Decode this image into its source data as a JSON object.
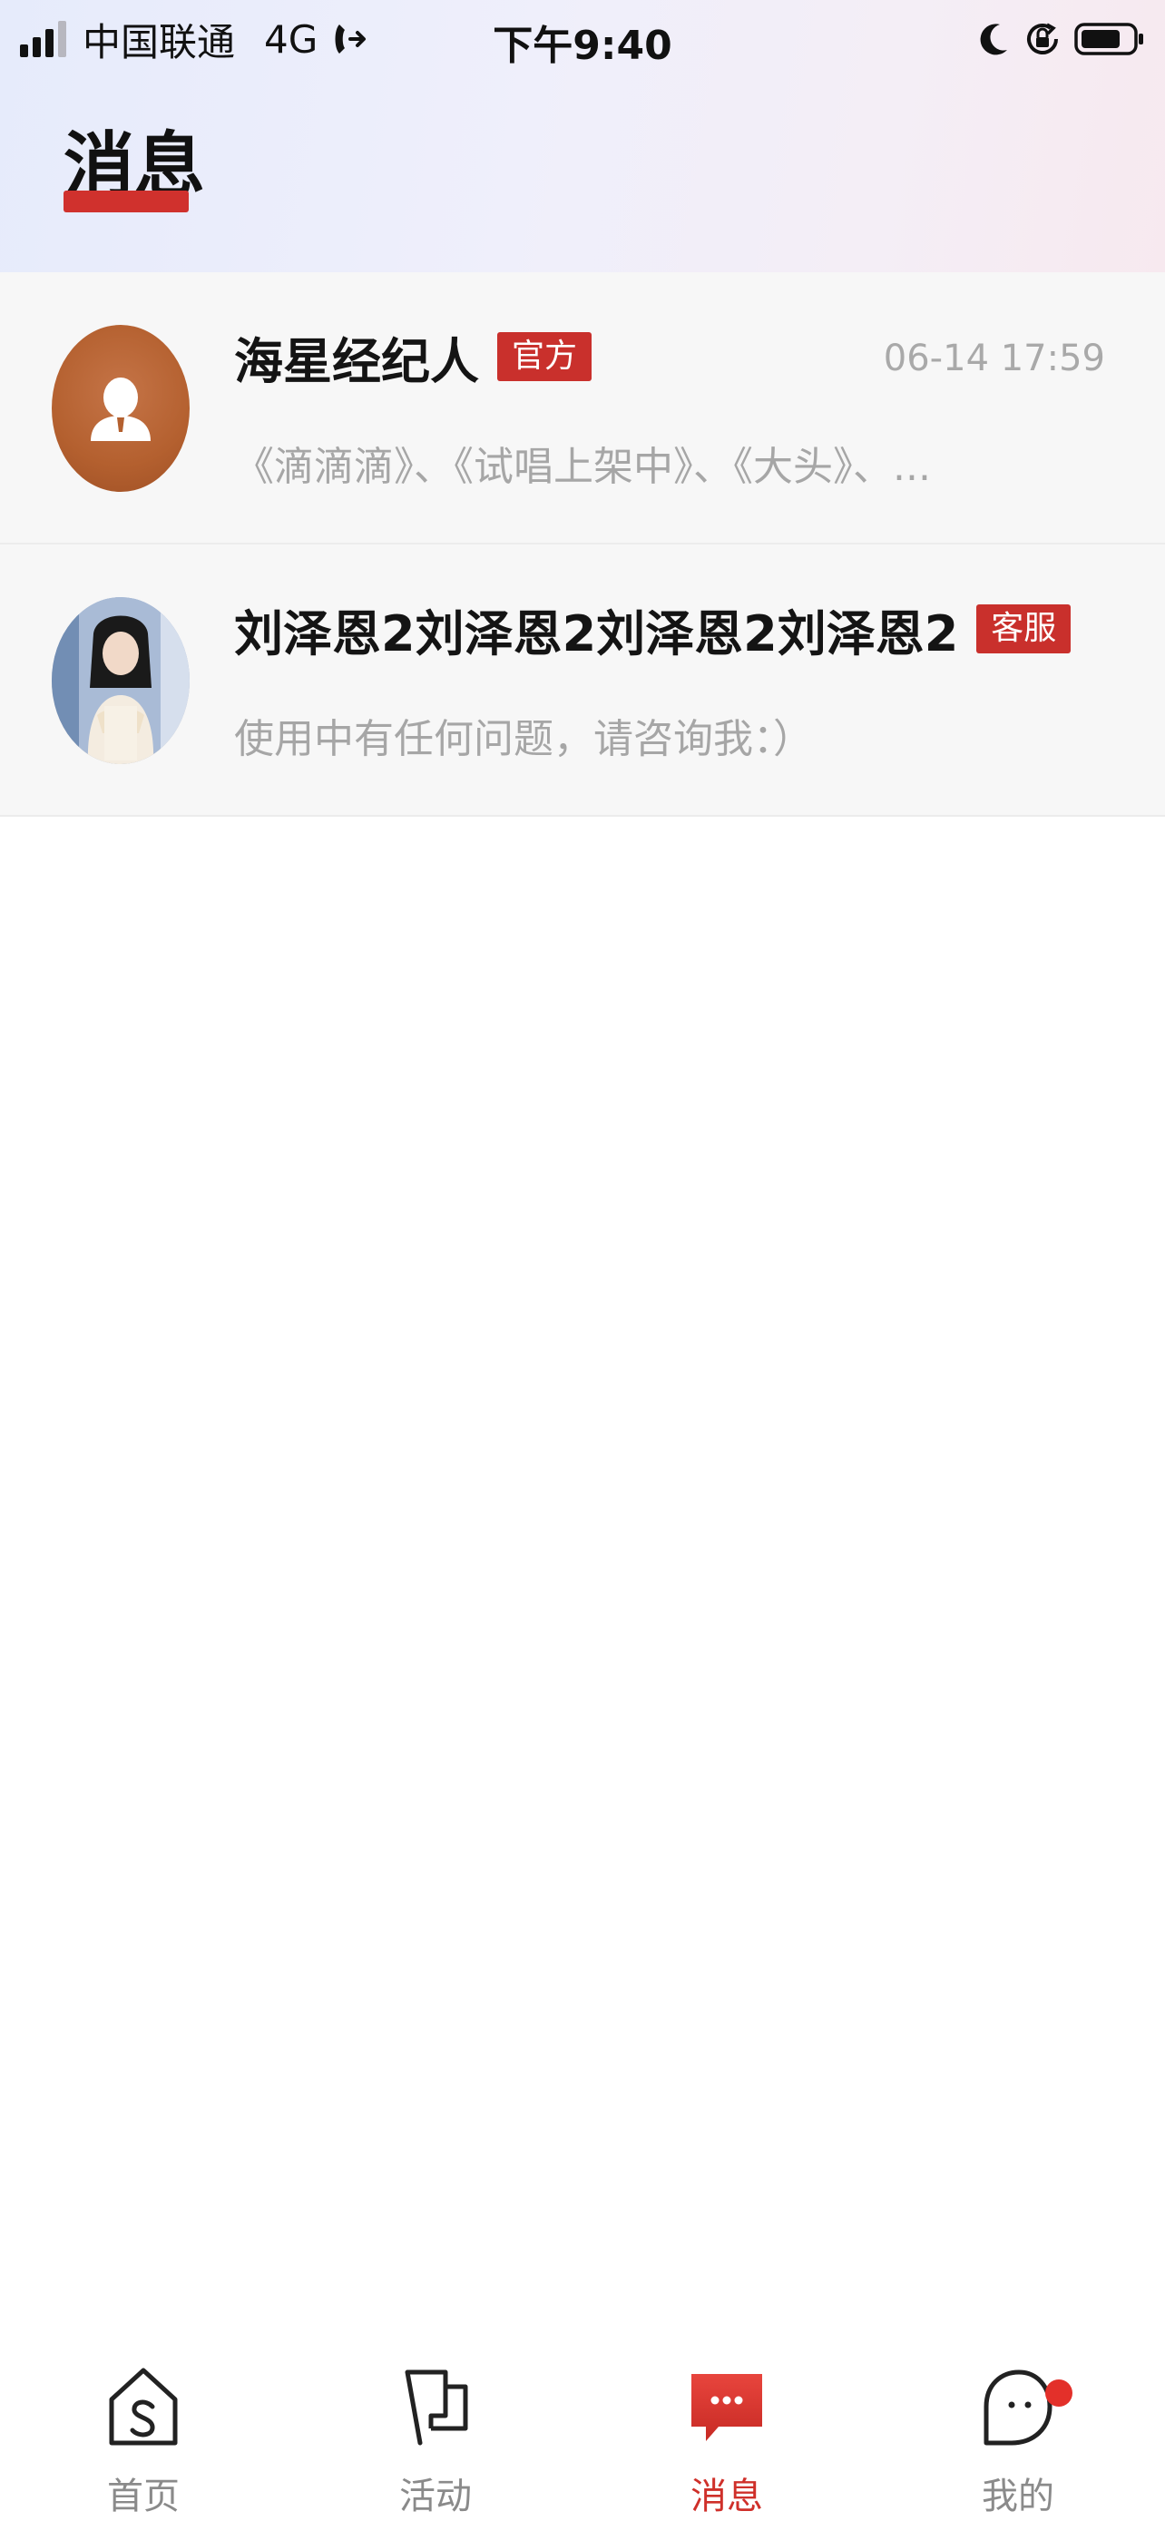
{
  "status_bar": {
    "carrier": "中国联通",
    "network": "4G",
    "time": "下午9:40"
  },
  "header": {
    "title": "消息"
  },
  "conversations": [
    {
      "name": "海星经纪人",
      "badge": "官方",
      "time": "06-14 17:59",
      "preview": "《滴滴滴》、《试唱上架中》、《大头》、...",
      "avatar_icon": "person-placeholder-icon"
    },
    {
      "name": "刘泽恩2刘泽恩2刘泽恩2刘泽恩2",
      "badge": "客服",
      "time": "",
      "preview": "使用中有任何问题，请咨询我：）",
      "avatar_icon": "user-photo"
    }
  ],
  "tabbar": {
    "items": [
      {
        "label": "首页",
        "icon": "home-icon",
        "active": false
      },
      {
        "label": "活动",
        "icon": "flag-icon",
        "active": false
      },
      {
        "label": "消息",
        "icon": "message-icon",
        "active": true
      },
      {
        "label": "我的",
        "icon": "ghost-face-icon",
        "active": false,
        "badge_dot": true
      }
    ]
  },
  "colors": {
    "accent": "#cf302a",
    "badge_bg": "#c9302c",
    "row_bg": "#f7f7f7",
    "muted_text": "#a6a6a6"
  }
}
